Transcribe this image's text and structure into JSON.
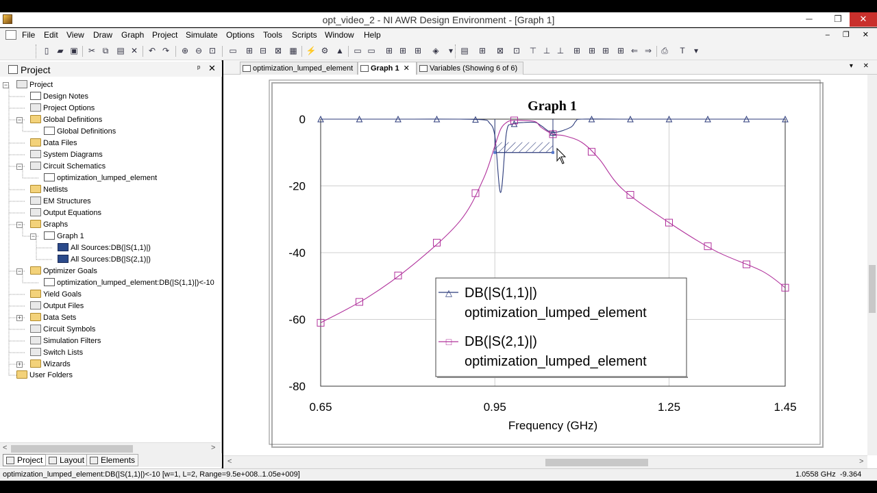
{
  "window": {
    "title": "opt_video_2 - NI AWR Design Environment - [Graph 1]",
    "minimize": "─",
    "restore": "❐",
    "close": "✕"
  },
  "menu": {
    "items": [
      "File",
      "Edit",
      "View",
      "Draw",
      "Graph",
      "Project",
      "Simulate",
      "Options",
      "Tools",
      "Scripts",
      "Window",
      "Help"
    ],
    "mdi_buttons": "– ❐ ✕"
  },
  "project_panel": {
    "title": "Project",
    "pin": "ᵖ",
    "close": "✕",
    "tree": [
      {
        "label": "Project",
        "icon": "project-icon",
        "exp": "−"
      },
      {
        "label": "Design Notes",
        "icon": "notes-icon"
      },
      {
        "label": "Project Options",
        "icon": "options-icon"
      },
      {
        "label": "Global Definitions",
        "icon": "folder-icon",
        "exp": "−"
      },
      {
        "label": "Global Definitions",
        "icon": "definitions-icon"
      },
      {
        "label": "Data Files",
        "icon": "folder-icon"
      },
      {
        "label": "System Diagrams",
        "icon": "diagram-icon"
      },
      {
        "label": "Circuit Schematics",
        "icon": "schematic-icon",
        "exp": "−"
      },
      {
        "label": "optimization_lumped_element",
        "icon": "schematic-icon"
      },
      {
        "label": "Netlists",
        "icon": "folder-icon"
      },
      {
        "label": "EM Structures",
        "icon": "em-icon"
      },
      {
        "label": "Output Equations",
        "icon": "equations-icon"
      },
      {
        "label": "Graphs",
        "icon": "folder-icon",
        "exp": "−"
      },
      {
        "label": "Graph 1",
        "icon": "graph-icon",
        "exp": "−"
      },
      {
        "label": "All Sources:DB(|S(1,1)|)",
        "icon": "measurement-icon"
      },
      {
        "label": "All Sources:DB(|S(2,1)|)",
        "icon": "measurement-icon"
      },
      {
        "label": "Optimizer Goals",
        "icon": "folder-icon",
        "exp": "−"
      },
      {
        "label": "optimization_lumped_element:DB(|S(1,1)|)<-10",
        "icon": "goal-icon"
      },
      {
        "label": "Yield Goals",
        "icon": "yield-icon"
      },
      {
        "label": "Output Files",
        "icon": "output-icon"
      },
      {
        "label": "Data Sets",
        "icon": "datasets-icon",
        "exp": "+"
      },
      {
        "label": "Circuit Symbols",
        "icon": "symbols-icon"
      },
      {
        "label": "Simulation Filters",
        "icon": "filters-icon"
      },
      {
        "label": "Switch Lists",
        "icon": "switch-icon"
      },
      {
        "label": "Wizards",
        "icon": "wizards-icon",
        "exp": "+"
      },
      {
        "label": "User Folders",
        "icon": "folder-icon"
      }
    ],
    "tabs": [
      "Project",
      "Layout",
      "Elements"
    ]
  },
  "doc_tabs": [
    {
      "label": "optimization_lumped_element"
    },
    {
      "label": "Graph 1",
      "close": "✕"
    },
    {
      "label": "Variables (Showing 6 of 6)"
    }
  ],
  "doc_menu": "▾ ✕",
  "chart_data": {
    "type": "line",
    "title": "Graph 1",
    "xlabel": "Frequency (GHz)",
    "ylabel": "",
    "xlim": [
      0.65,
      1.45
    ],
    "ylim": [
      -80,
      0
    ],
    "xticks": [
      "0.65",
      "0.95",
      "1.25",
      "1.45"
    ],
    "yticks": [
      "0",
      "-20",
      "-40",
      "-60",
      "-80"
    ],
    "grid": true,
    "legend_position": "center-right",
    "series": [
      {
        "name": "DB(|S(1,1)|)",
        "source": "optimization_lumped_element",
        "marker": "triangle",
        "color": "#2b3a7a",
        "x": [
          0.65,
          0.73,
          0.81,
          0.89,
          0.93,
          0.94,
          0.95,
          0.96,
          0.97,
          0.98,
          1.0,
          1.02,
          1.03,
          1.05,
          1.08,
          1.09,
          1.1,
          1.17,
          1.25,
          1.33,
          1.41,
          1.45
        ],
        "y": [
          0,
          0,
          0,
          0,
          -0.2,
          -1,
          -5,
          -22,
          -4,
          -1.5,
          -1,
          -1,
          -2,
          -4,
          -2.5,
          -0.5,
          0,
          0,
          0,
          0,
          0,
          0
        ]
      },
      {
        "name": "DB(|S(2,1)|)",
        "source": "optimization_lumped_element",
        "marker": "square",
        "color": "#b0309b",
        "x": [
          0.65,
          0.73,
          0.81,
          0.89,
          0.93,
          0.95,
          0.96,
          0.97,
          0.98,
          1.0,
          1.02,
          1.03,
          1.05,
          1.07,
          1.1,
          1.13,
          1.17,
          1.25,
          1.33,
          1.41,
          1.45
        ],
        "y": [
          -61,
          -53.5,
          -43.5,
          -30.5,
          -18,
          -8,
          -3,
          -1,
          -0.4,
          -0.4,
          -0.8,
          -2.5,
          -4.5,
          -5,
          -7,
          -12,
          -21,
          -31,
          -39.5,
          -45.5,
          -50.5
        ]
      }
    ],
    "goal": {
      "label": "DB(|S(1,1)|)<-10",
      "x_range": [
        0.95,
        1.05
      ],
      "y": -10
    },
    "markers": {
      "triangle": "△",
      "square": "□"
    }
  },
  "status": {
    "goal_text": "optimization_lumped_element:DB(|S(1,1)|)<-10 [w=1, L=2, Range=9.5e+008..1.05e+009]",
    "frequency": "1.0558 GHz",
    "value": "-9.364"
  }
}
